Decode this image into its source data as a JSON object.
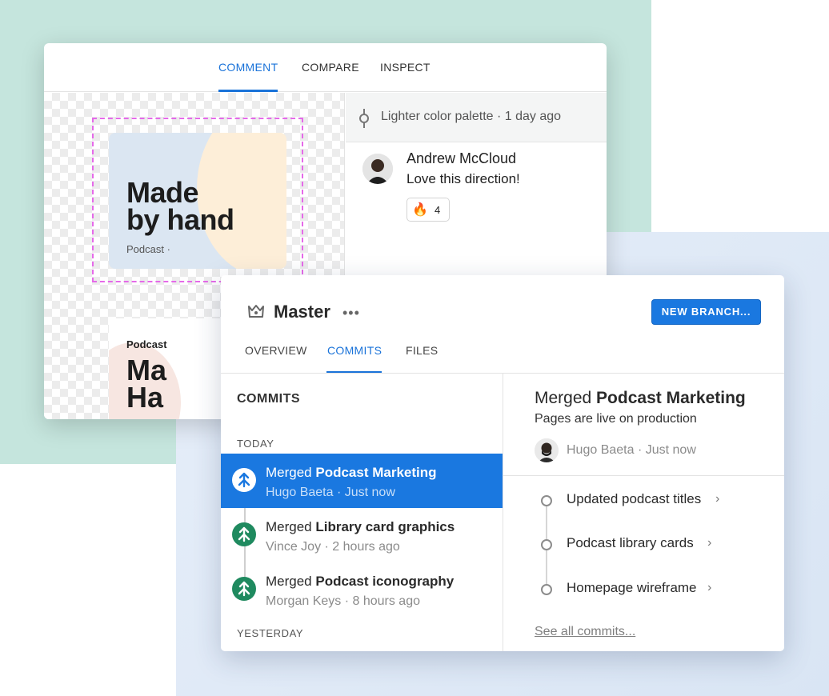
{
  "back": {
    "tabs": [
      {
        "label": "COMMENT",
        "active": true
      },
      {
        "label": "COMPARE",
        "active": false
      },
      {
        "label": "INSPECT",
        "active": false
      }
    ],
    "card1": {
      "title_line1": "Made",
      "title_line2": "by hand",
      "subtitle": "Podcast ·"
    },
    "card2": {
      "label": "Podcast",
      "title_line1": "Ma",
      "title_line2": "Ha"
    },
    "thread": {
      "title": "Lighter color palette",
      "time": "· 1 day ago"
    },
    "comment": {
      "author": "Andrew McCloud",
      "text": "Love this direction!",
      "reaction_emoji": "🔥",
      "reaction_count": "4"
    }
  },
  "front": {
    "title": "Master",
    "more": "•••",
    "new_branch_label": "NEW BRANCH...",
    "tabs": [
      {
        "label": "OVERVIEW",
        "active": false
      },
      {
        "label": "COMMITS",
        "active": true
      },
      {
        "label": "FILES",
        "active": false
      }
    ],
    "commits_header": "COMMITS",
    "today_label": "TODAY",
    "yesterday_label": "YESTERDAY",
    "commits": [
      {
        "prefix": "Merged ",
        "name": "Podcast Marketing",
        "author": "Hugo Baeta",
        "time": "Just now",
        "selected": true
      },
      {
        "prefix": "Merged ",
        "name": "Library card graphics",
        "author": "Vince Joy",
        "time": "2 hours ago",
        "selected": false
      },
      {
        "prefix": "Merged ",
        "name": "Podcast iconography",
        "author": "Morgan Keys",
        "time": "8 hours ago",
        "selected": false
      }
    ],
    "detail": {
      "prefix": "Merged ",
      "name": "Podcast Marketing",
      "subtitle": "Pages are live on production",
      "author": "Hugo Baeta",
      "time": "Just now",
      "items": [
        "Updated podcast titles",
        "Podcast library cards",
        "Homepage wireframe"
      ],
      "see_all": "See all commits..."
    }
  },
  "colors": {
    "accent": "#1a78e0",
    "merge_green": "#1f8a5f",
    "bg_mint": "#c5e5dd",
    "bg_blue": "#dce7f5",
    "selection_dash": "#e56ae9"
  }
}
